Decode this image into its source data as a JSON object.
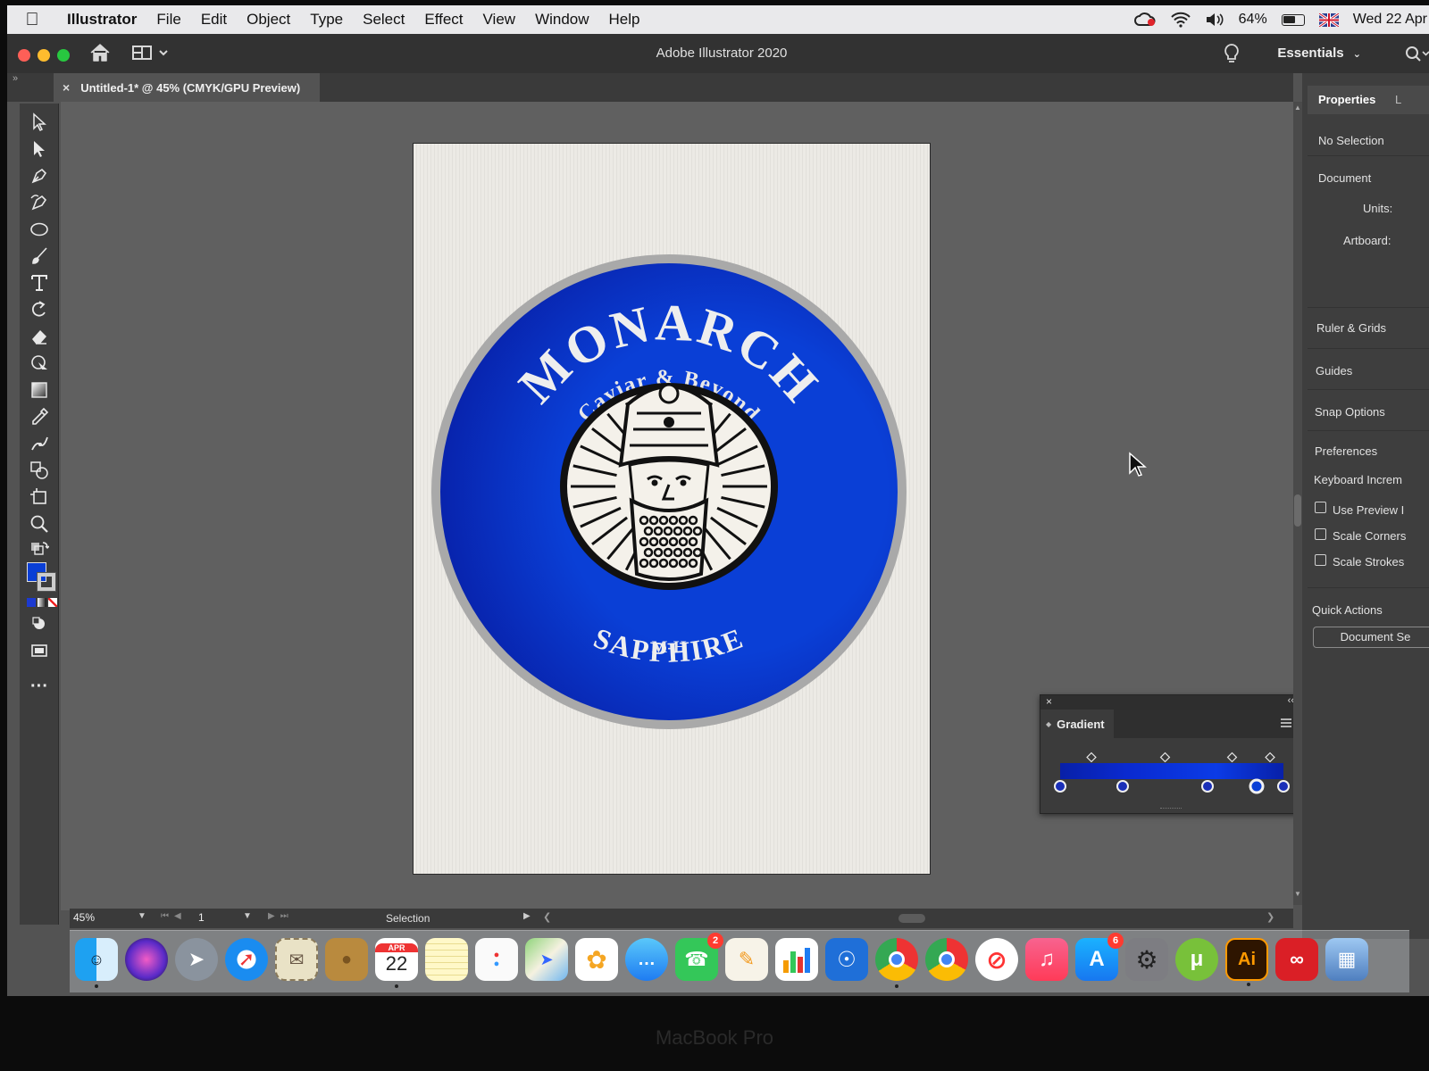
{
  "menubar": {
    "app_name": "Illustrator",
    "items": [
      "File",
      "Edit",
      "Object",
      "Type",
      "Select",
      "Effect",
      "View",
      "Window",
      "Help"
    ],
    "battery": "64%",
    "battery_level": 0.64,
    "datetime": "Wed 22 Apr"
  },
  "titlebar": {
    "title": "Adobe Illustrator 2020",
    "workspace": "Essentials"
  },
  "document_tab": {
    "close": "×",
    "label": "Untitled-1* @ 45% (CMYK/GPU Preview)"
  },
  "artwork": {
    "brand": "MONARCH",
    "tagline": "Caviar & Beyond",
    "initials": "M-H",
    "product": "SAPPHIRE",
    "colors": {
      "blue": "#0a3fd6",
      "blue_dark": "#0820a8",
      "ring": "#a9a9a9"
    }
  },
  "statusbar": {
    "zoom": "45%",
    "page": "1",
    "tool": "Selection"
  },
  "properties": {
    "tab": "Properties",
    "tab2": "L",
    "no_selection": "No Selection",
    "document": "Document",
    "units": "Units:",
    "artboard": "Artboard:",
    "ruler_grids": "Ruler & Grids",
    "guides": "Guides",
    "snap_options": "Snap Options",
    "preferences": "Preferences",
    "keyboard_increment": "Keyboard Increm",
    "use_preview": "Use Preview I",
    "scale_corners": "Scale Corners",
    "scale_strokes": "Scale Strokes",
    "quick_actions": "Quick Actions",
    "document_setup": "Document Se"
  },
  "gradient_panel": {
    "close": "×",
    "collapse": "‹‹",
    "title": "Gradient",
    "stop_count": 5
  },
  "dock": {
    "calendar_month": "APR",
    "calendar_day": "22",
    "facetime_badge": "2",
    "appstore_badge": "6",
    "illustrator_label": "Ai"
  },
  "bezel": "MacBook Pro"
}
